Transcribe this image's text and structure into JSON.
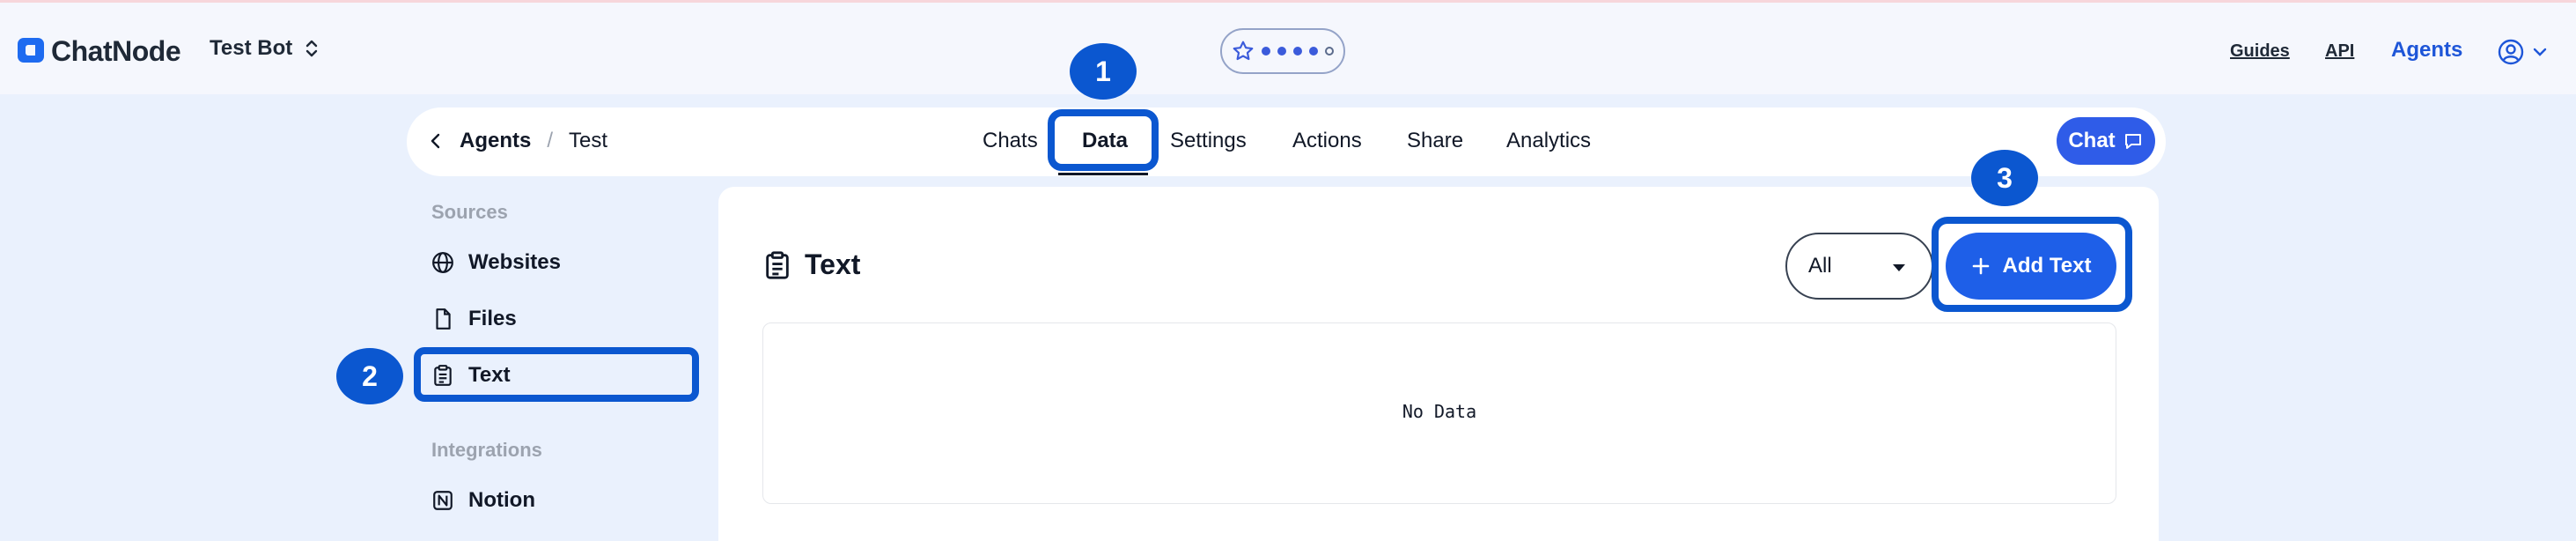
{
  "header": {
    "brand": "ChatNode",
    "bot_name": "Test Bot",
    "rating": {
      "filled": 4,
      "total": 5
    },
    "links": {
      "guides": "Guides",
      "api": "API",
      "agents": "Agents"
    }
  },
  "breadcrumb": {
    "parent": "Agents",
    "current": "Test"
  },
  "tabs": [
    "Chats",
    "Data",
    "Settings",
    "Actions",
    "Share",
    "Analytics"
  ],
  "chat_button": "Chat",
  "sidebar": {
    "sources_heading": "Sources",
    "sources": [
      {
        "label": "Websites",
        "icon": "globe-icon"
      },
      {
        "label": "Files",
        "icon": "file-icon"
      },
      {
        "label": "Text",
        "icon": "clipboard-icon"
      }
    ],
    "integrations_heading": "Integrations",
    "integrations": [
      {
        "label": "Notion",
        "icon": "notion-icon"
      }
    ]
  },
  "panel": {
    "title": "Text",
    "filter_value": "All",
    "add_button": "Add Text",
    "empty_text": "No Data"
  },
  "annotations": {
    "one": "1",
    "two": "2",
    "three": "3"
  },
  "colors": {
    "accent": "#1e5fe8",
    "highlight": "#0b57d0",
    "background": "#eaf1fd"
  }
}
